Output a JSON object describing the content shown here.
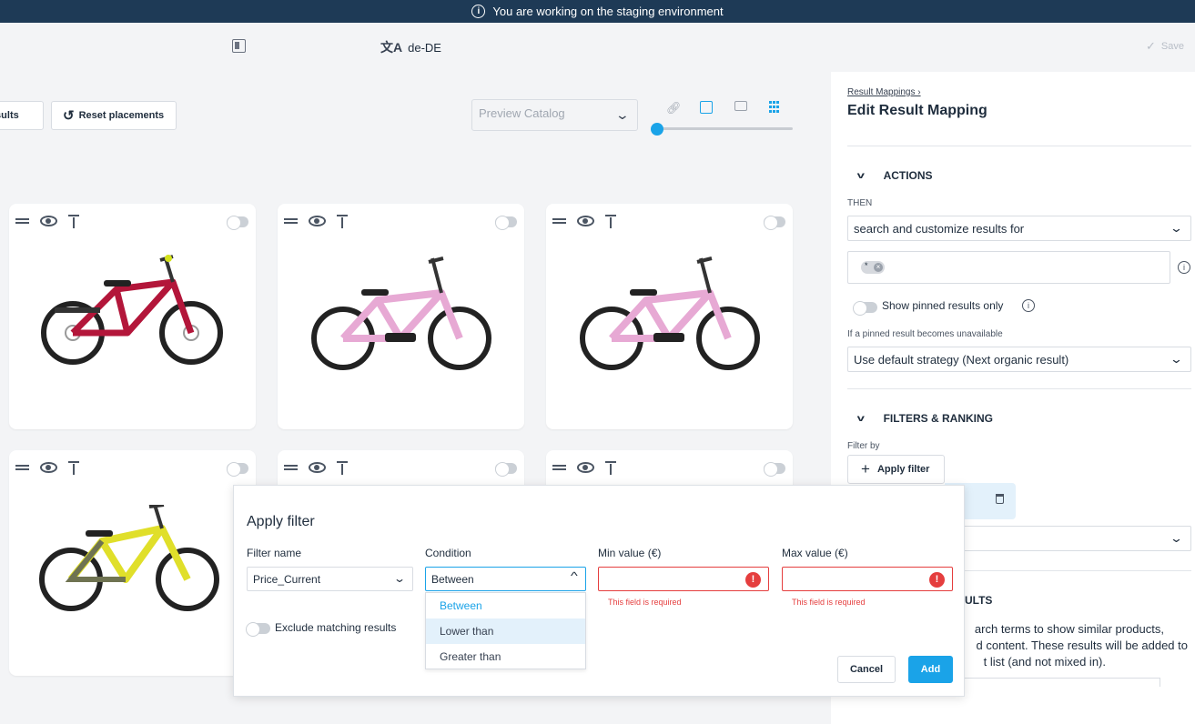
{
  "banner": {
    "text": "You are working on the staging environment"
  },
  "topbar": {
    "language": "de-DE",
    "save_label": "Save"
  },
  "toolbar": {
    "results_label": "Results",
    "reset_label": "Reset placements",
    "catalog_placeholder": "Preview Catalog"
  },
  "sidebar": {
    "breadcrumb": "Result Mappings",
    "title": "Edit Result Mapping",
    "actions": {
      "heading": "ACTIONS",
      "then_label": "THEN",
      "then_value": "search and customize results for",
      "show_pinned_label": "Show pinned results only",
      "unavailable_label": "If a pinned result becomes unavailable",
      "strategy_value": "Use default strategy (Next organic result)"
    },
    "filters": {
      "heading": "FILTERS & RANKING",
      "filter_by_label": "Filter by",
      "apply_filter_label": "Apply filter"
    },
    "partial": {
      "heading_fragment": "ULTS",
      "lines": [
        "arch terms to show similar products,",
        "d content. These results will be added to",
        "t list (and not mixed in)."
      ]
    }
  },
  "modal": {
    "title": "Apply filter",
    "filter_name_label": "Filter name",
    "filter_name_value": "Price_Current",
    "condition_label": "Condition",
    "condition_value": "Between",
    "condition_options": [
      "Between",
      "Lower than",
      "Greater than"
    ],
    "min_label": "Min value (€)",
    "max_label": "Max value (€)",
    "required_error": "This field is required",
    "exclude_label": "Exclude matching results",
    "cancel_label": "Cancel",
    "add_label": "Add"
  },
  "colors": {
    "accent": "#1aa3e8",
    "banner": "#1e3a56",
    "error": "#e53e3e"
  }
}
